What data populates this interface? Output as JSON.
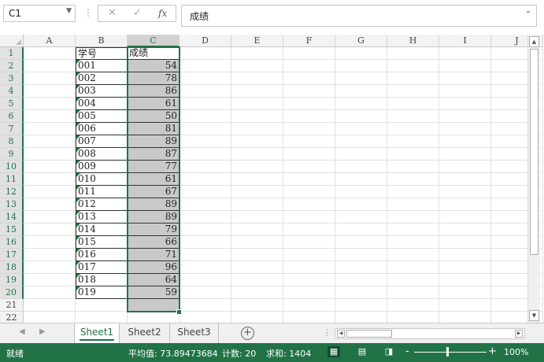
{
  "formula_bar": {
    "name_box": "C1",
    "cancel_icon": "✕",
    "enter_icon": "✓",
    "fx_label": "fx",
    "formula_value": "成绩",
    "expand_icon": "⌃"
  },
  "columns": [
    "A",
    "B",
    "C",
    "D",
    "E",
    "F",
    "G",
    "H",
    "I",
    "J"
  ],
  "rows": [
    "1",
    "2",
    "3",
    "4",
    "5",
    "6",
    "7",
    "8",
    "9",
    "10",
    "11",
    "12",
    "13",
    "14",
    "15",
    "16",
    "17",
    "18",
    "19",
    "20",
    "21",
    "22"
  ],
  "table": {
    "header_id": "学号",
    "header_score": "成绩",
    "records": [
      {
        "id": "001",
        "score": "54"
      },
      {
        "id": "002",
        "score": "78"
      },
      {
        "id": "003",
        "score": "86"
      },
      {
        "id": "004",
        "score": "61"
      },
      {
        "id": "005",
        "score": "50"
      },
      {
        "id": "006",
        "score": "81"
      },
      {
        "id": "007",
        "score": "89"
      },
      {
        "id": "008",
        "score": "87"
      },
      {
        "id": "009",
        "score": "77"
      },
      {
        "id": "010",
        "score": "61"
      },
      {
        "id": "011",
        "score": "67"
      },
      {
        "id": "012",
        "score": "89"
      },
      {
        "id": "013",
        "score": "89"
      },
      {
        "id": "014",
        "score": "79"
      },
      {
        "id": "015",
        "score": "66"
      },
      {
        "id": "016",
        "score": "71"
      },
      {
        "id": "017",
        "score": "96"
      },
      {
        "id": "018",
        "score": "64"
      },
      {
        "id": "019",
        "score": "59"
      }
    ]
  },
  "sheet_tabs": {
    "nav_prev": "◀",
    "nav_next": "▶",
    "tabs": [
      "Sheet1",
      "Sheet2",
      "Sheet3"
    ],
    "active": "Sheet1",
    "add_icon": "+"
  },
  "status_bar": {
    "mode": "就绪",
    "average": "平均值: 73.89473684",
    "count": "计数: 20",
    "sum": "求和: 1404",
    "zoom_minus": "-",
    "zoom_plus": "+",
    "zoom": "100%"
  },
  "colors": {
    "accent": "#217346",
    "selection_fill": "#c9c9c9"
  }
}
